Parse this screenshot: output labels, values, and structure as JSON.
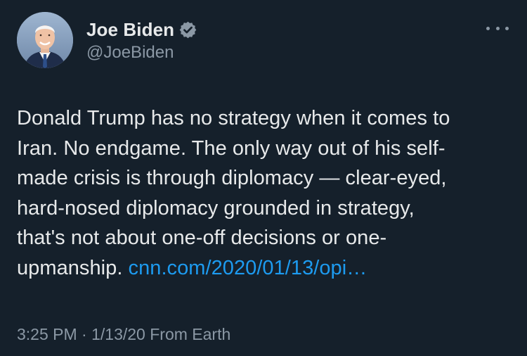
{
  "author": {
    "display_name": "Joe Biden",
    "handle": "@JoeBiden",
    "verified_icon": "verified-badge-icon",
    "avatar": "profile-photo"
  },
  "menu": {
    "icon": "more-options-icon"
  },
  "tweet": {
    "lines": [
      "Donald Trump has no strategy when it comes to",
      "Iran. No endgame. The only way out of his self-",
      "made crisis is through diplomacy — clear-eyed,",
      "hard-nosed diplomacy grounded in strategy,",
      "that's not about one-off decisions or one-"
    ],
    "last_line_text": "upmanship. ",
    "link_text": "cnn.com/2020/01/13/opi…"
  },
  "meta": {
    "time": "3:25 PM",
    "separator": " · ",
    "date": "1/13/20",
    "source": " From Earth"
  },
  "colors": {
    "background": "#15202b",
    "text": "#e7e9ea",
    "secondary": "#8b98a5",
    "link": "#1d9bf0"
  }
}
